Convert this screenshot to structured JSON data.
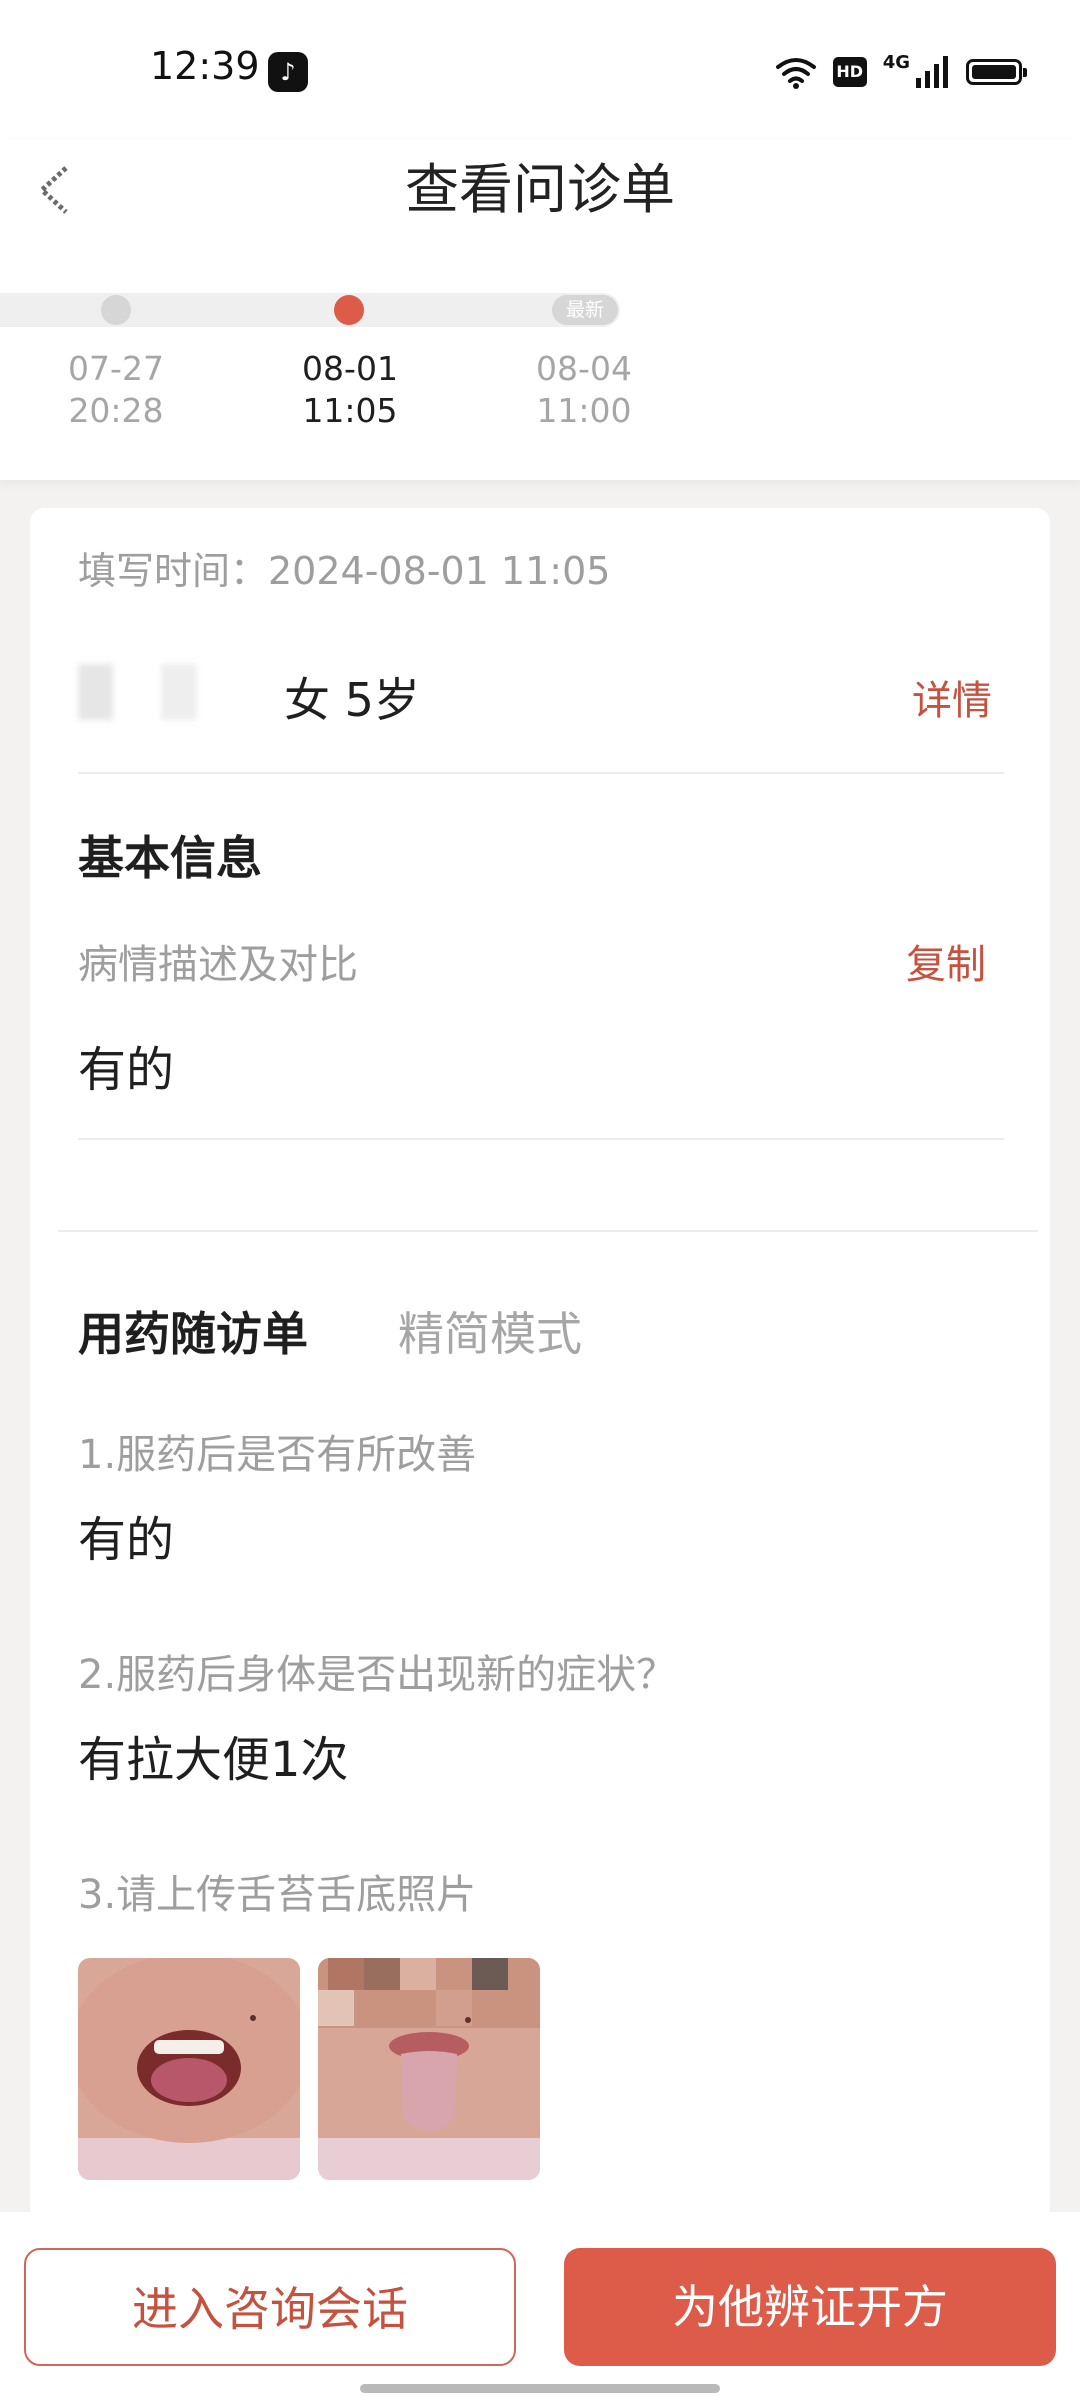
{
  "status_bar": {
    "time": "12:39",
    "hd": "HD",
    "network": "4G"
  },
  "header": {
    "title": "查看问诊单"
  },
  "timeline": {
    "newest_badge": "最新",
    "entries": [
      {
        "date": "07-27",
        "time": "20:28"
      },
      {
        "date": "08-01",
        "time": "11:05"
      },
      {
        "date": "08-04",
        "time": "11:00"
      }
    ]
  },
  "card": {
    "fill_time": "填写时间：2024-08-01 11:05",
    "patient_info": "女 5岁",
    "details_link": "详情",
    "basic_info": {
      "title": "基本信息",
      "condition_label": "病情描述及对比",
      "copy_link": "复制",
      "condition_value": "有的"
    },
    "followup": {
      "title": "用药随访单",
      "mode_toggle": "精简模式",
      "questions": [
        {
          "question": "1.服药后是否有所改善",
          "answer": "有的"
        },
        {
          "question": "2.服药后身体是否出现新的症状？",
          "answer": "有拉大便1次"
        },
        {
          "question": "3.请上传舌苔舌底照片",
          "answer": ""
        }
      ]
    }
  },
  "actions": {
    "enter_chat": "进入咨询会话",
    "prescribe": "为他辨证开方"
  },
  "colors": {
    "accent": "#dd5b49",
    "accent_text": "#c4523f",
    "muted": "#9e9e9e"
  }
}
